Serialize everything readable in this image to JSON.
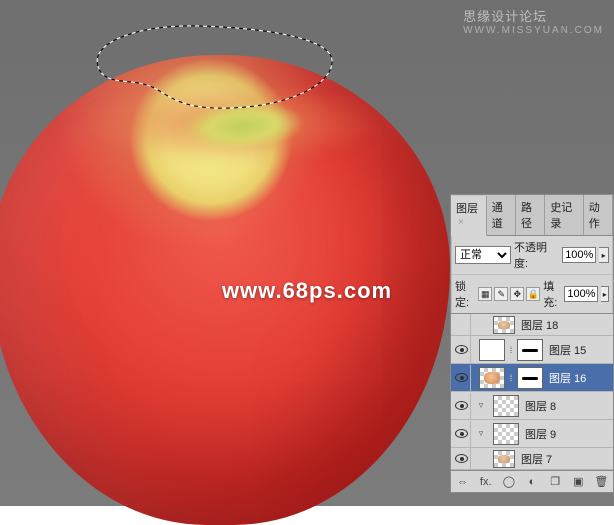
{
  "watermarks": {
    "top_main": "思缘设计论坛",
    "top_sub": "WWW.MISSYUAN.COM",
    "center": "www.68ps.com"
  },
  "panel": {
    "tabs": {
      "layers": "图层",
      "channels": "通道",
      "paths": "路径",
      "history": "史记录",
      "actions": "动作"
    },
    "blend_mode_label": "正常",
    "opacity_label": "不透明度:",
    "opacity_value": "100%",
    "lock_label": "锁定:",
    "fill_label": "填充:",
    "fill_value": "100%",
    "layers": [
      {
        "name": "图层 18"
      },
      {
        "name": "图层 15"
      },
      {
        "name": "图层 16"
      },
      {
        "name": "图层 8"
      },
      {
        "name": "图层 9"
      },
      {
        "name": "图层 7"
      }
    ],
    "footer_icons": {
      "link": "⇔",
      "fx": "fx.",
      "mask": "◯",
      "adjust": "◐",
      "folder": "❐",
      "new": "▣",
      "trash": "🗑"
    }
  }
}
